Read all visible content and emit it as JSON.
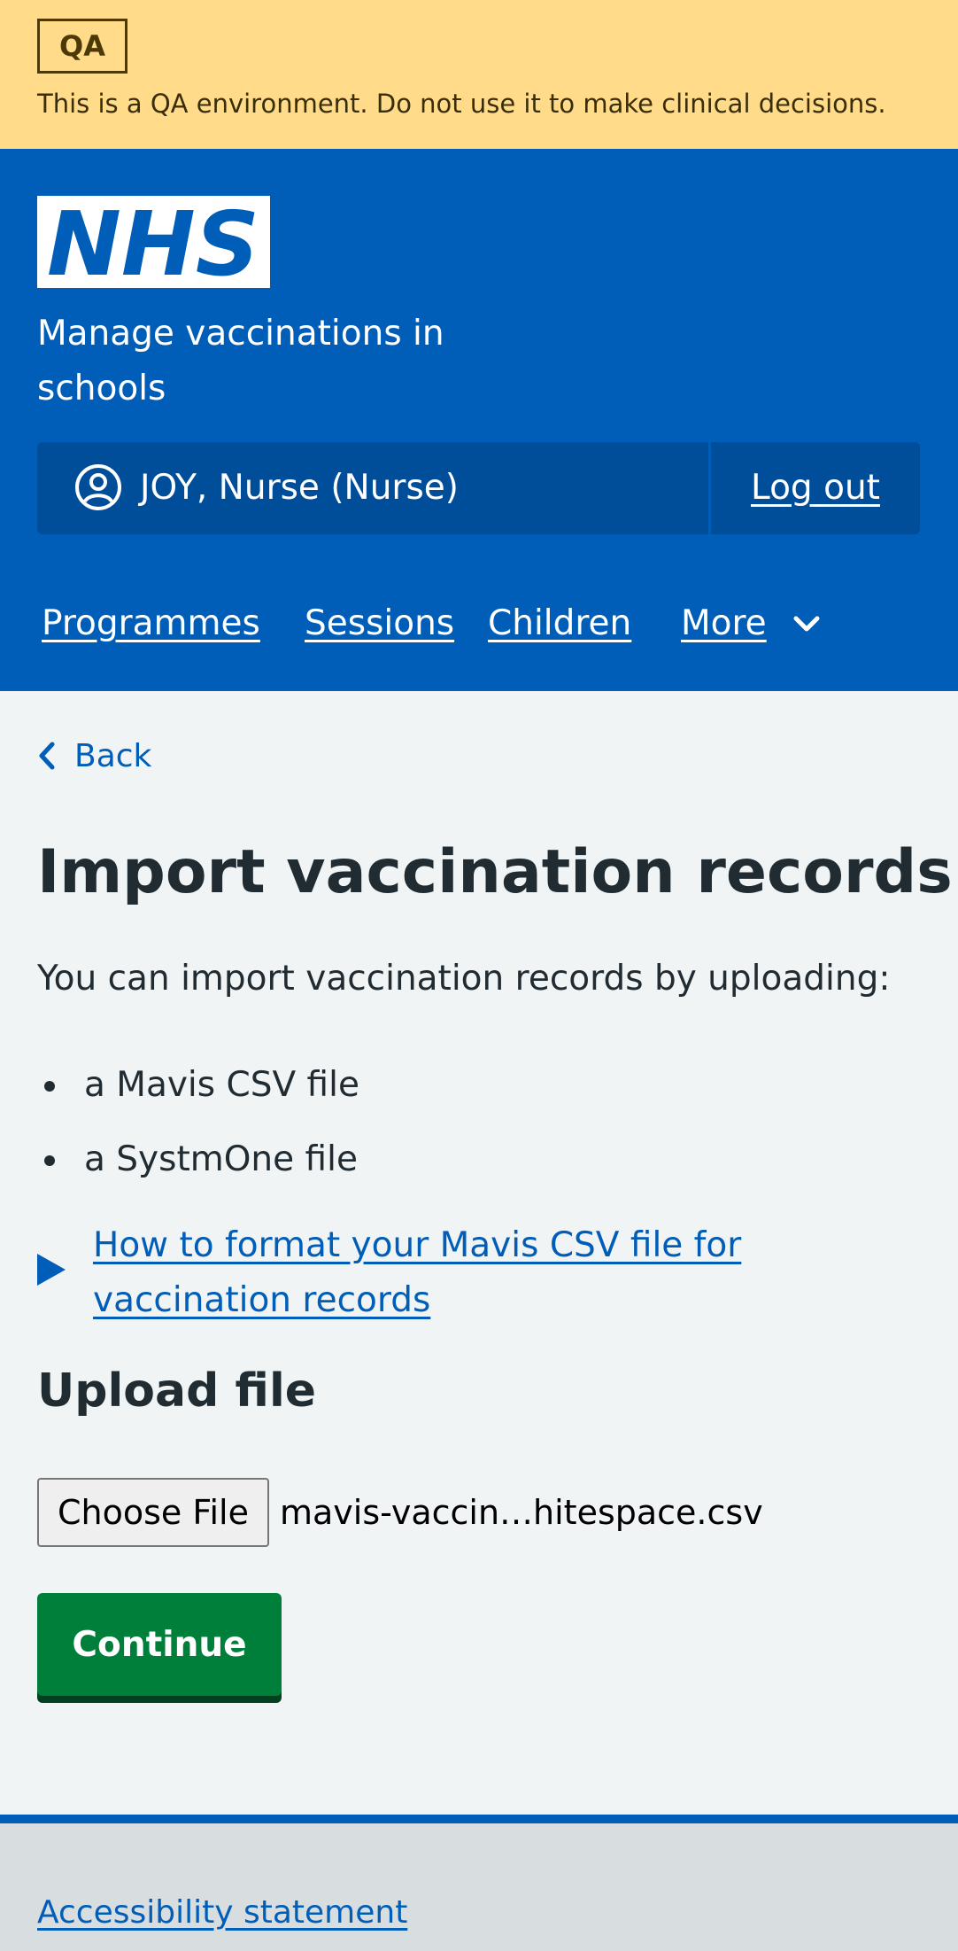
{
  "qa_banner": {
    "tag": "QA",
    "message": "This is a QA environment. Do not use it to make clinical decisions.",
    "background_color": "#ffdb8a"
  },
  "header": {
    "logo_text": "NHS",
    "service_name": "Manage vaccinations in schools",
    "account": {
      "user_icon": "user-circle-icon",
      "name": "JOY, Nurse (Nurse)",
      "logout_label": "Log out"
    },
    "nav": {
      "items": [
        "Programmes",
        "Sessions",
        "Children"
      ],
      "more_label": "More",
      "more_icon": "chevron-down-icon"
    },
    "background_color": "#005eb8"
  },
  "main": {
    "back_label": "Back",
    "back_icon": "chevron-left-icon",
    "title": "Import vaccination records",
    "intro": "You can import vaccination records by uploading:",
    "file_types": [
      "a Mavis CSV file",
      "a SystmOne file"
    ],
    "details_summary": "How to format your Mavis CSV file for vaccination records",
    "details_icon": "triangle-right-icon",
    "upload": {
      "heading": "Upload file",
      "choose_button": "Choose File",
      "selected_file": "mavis-vaccin…hitespace.csv"
    },
    "continue_label": "Continue",
    "continue_color": "#007f3b"
  },
  "footer": {
    "accessibility_link": "Accessibility statement"
  }
}
